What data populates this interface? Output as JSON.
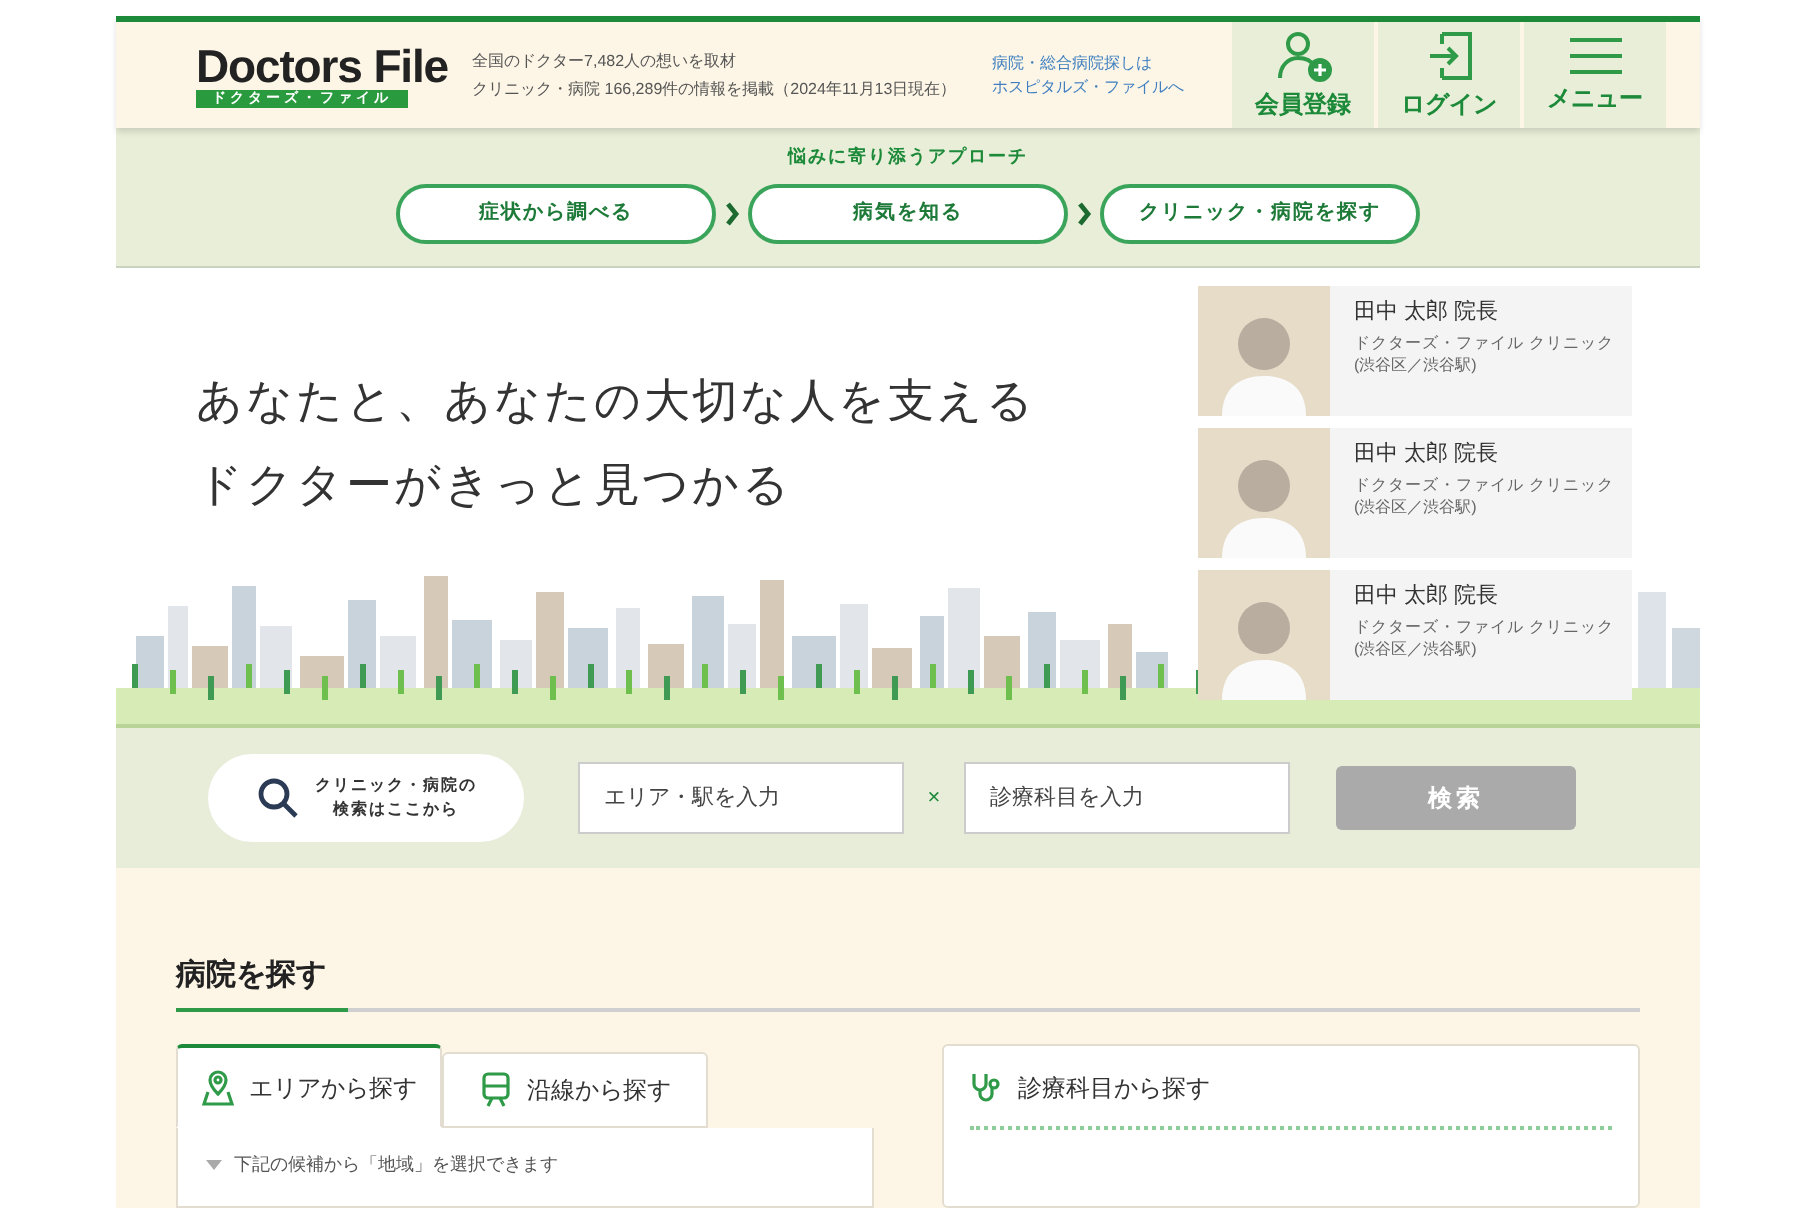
{
  "header": {
    "logo": {
      "title": "Doctors File",
      "subtitle": "ドクターズ・ファイル"
    },
    "tagline": [
      "全国のドクター7,482人の想いを取材",
      "クリニック・病院 166,289件の情報を掲載（2024年11月13日現在）"
    ],
    "hospital_link": [
      "病院・総合病院探しは",
      "ホスピタルズ・ファイルへ"
    ],
    "actions": [
      {
        "label": "会員登録",
        "kind": "register"
      },
      {
        "label": "ログイン",
        "kind": "login"
      },
      {
        "label": "メニュー",
        "kind": "menu"
      }
    ]
  },
  "approach": {
    "title": "悩みに寄り添うアプローチ",
    "steps": [
      "症状から調べる",
      "病気を知る",
      "クリニック・病院を探す"
    ]
  },
  "hero": {
    "headline": [
      "あなたと、あなたの大切な人を支える",
      "ドクターがきっと見つかる"
    ],
    "doctors": [
      {
        "name": "田中 太郎 院長",
        "clinic": "ドクターズ・ファイル クリニック",
        "location": "(渋谷区／渋谷駅)"
      },
      {
        "name": "田中 太郎 院長",
        "clinic": "ドクターズ・ファイル クリニック",
        "location": "(渋谷区／渋谷駅)"
      },
      {
        "name": "田中 太郎 院長",
        "clinic": "ドクターズ・ファイル クリニック",
        "location": "(渋谷区／渋谷駅)"
      }
    ]
  },
  "search": {
    "prompt": [
      "クリニック・病院の",
      "検索はここから"
    ],
    "area_placeholder": "エリア・駅を入力",
    "separator": "×",
    "department_placeholder": "診療科目を入力",
    "button": "検索",
    "button_disabled": true
  },
  "hospital_search": {
    "title": "病院を探す",
    "tabs": [
      {
        "label": "エリアから探す",
        "kind": "area",
        "selected": true
      },
      {
        "label": "沿線から探す",
        "kind": "train",
        "selected": false
      }
    ],
    "hint": "下記の候補から「地域」を選択できます",
    "department_panel": {
      "title": "診療科目から探す"
    }
  }
}
